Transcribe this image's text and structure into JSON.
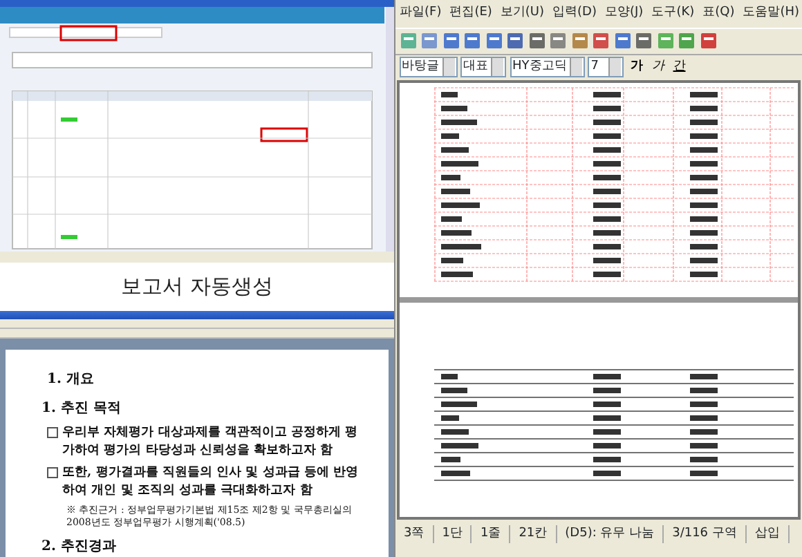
{
  "caption": "보고서 자동생성",
  "document_window": {
    "lines": [
      {
        "kind": "heading",
        "text": "1. 개요"
      },
      {
        "kind": "subheading",
        "text": "1. 추진 목적"
      },
      {
        "kind": "bullet",
        "text": "우리부 자체평가 대상과제를 객관적이고 공정하게 평가하여 평가의 타당성과 신뢰성을 확보하고자 함"
      },
      {
        "kind": "bullet",
        "text": "또한, 평가결과를 직원들의 인사 및 성과급 등에 반영하여 개인 및 조직의 성과를 극대화하고자 함"
      },
      {
        "kind": "note",
        "text": "※ 추진근거 : 정부업무평가기본법 제15조 제2항 및 국무총리실의 2008년도 정부업무평가 시행계획('08.5)"
      },
      {
        "kind": "subheading",
        "text": "2. 추진경과"
      }
    ]
  },
  "editor": {
    "menu": [
      "파일(F)",
      "편집(E)",
      "보기(U)",
      "입력(D)",
      "모양(J)",
      "도구(K)",
      "표(Q)",
      "도움말(H)"
    ],
    "format_bar": {
      "style": "바탕글",
      "font_group": "대표",
      "font": "HY중고딕",
      "size": "7",
      "format_buttons": [
        {
          "kind": "bold",
          "label": "가"
        },
        {
          "kind": "italic",
          "label": "가"
        },
        {
          "kind": "underline",
          "label": "간"
        }
      ]
    },
    "status_bar": [
      "3쪽",
      "1단",
      "1줄",
      "21칸",
      "(D5): 유무 나눔",
      "3/116 구역",
      "삽입"
    ]
  }
}
